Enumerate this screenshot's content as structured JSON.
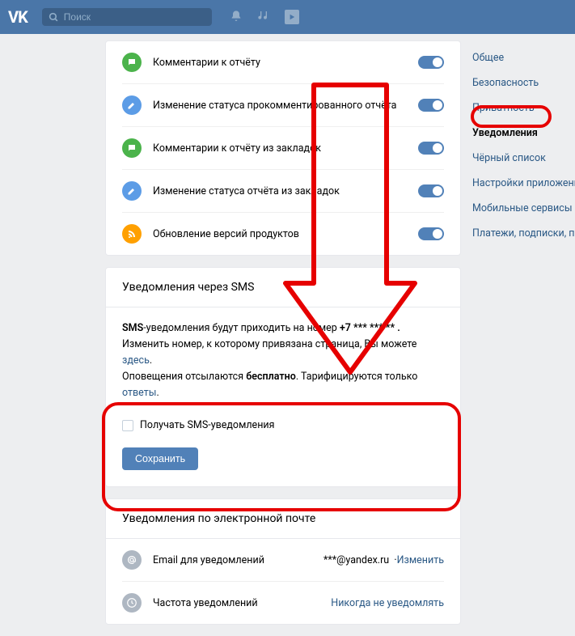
{
  "header": {
    "logo": "VK",
    "search_placeholder": "Поиск"
  },
  "settings_rows": [
    {
      "icon": "comment",
      "color": "green",
      "label": "Комментарии к отчёту"
    },
    {
      "icon": "edit",
      "color": "blue",
      "label": "Изменение статуса прокомментированного отчёта"
    },
    {
      "icon": "comment",
      "color": "green",
      "label": "Комментарии к отчёту из закладок"
    },
    {
      "icon": "edit",
      "color": "blue",
      "label": "Изменение статуса отчёта из закладок"
    },
    {
      "icon": "rss",
      "color": "orange",
      "label": "Обновление версий продуктов"
    }
  ],
  "sms": {
    "header": "Уведомления через SMS",
    "line1_pre": "SMS",
    "line1_post": "-уведомления будут приходить на номер ",
    "phone": "+7 *** *** ** .",
    "line2_pre": "Изменить номер, к которому привязана страница, Вы можете ",
    "line2_link": "здесь",
    "line2_post": ".",
    "line3_pre": "Оповещения отсылаются ",
    "line3_bold": "бесплатно",
    "line3_mid": ". Тарифицируются только ",
    "line3_link": "ответы",
    "line3_post": ".",
    "checkbox_label": "Получать SMS-уведомления",
    "save": "Сохранить"
  },
  "email": {
    "header": "Уведомления по электронной почте",
    "row1_label": "Email для уведомлений",
    "row1_value": "***@yandex.ru",
    "row1_action": "Изменить",
    "row2_label": "Частота уведомлений",
    "row2_action": "Никогда не уведомлять"
  },
  "sidebar": {
    "items": [
      "Общее",
      "Безопасность",
      "Приватность",
      "Уведомления",
      "Чёрный список",
      "Настройки приложений",
      "Мобильные сервисы",
      "Платежи, подписки, переводы"
    ],
    "active_index": 3
  }
}
